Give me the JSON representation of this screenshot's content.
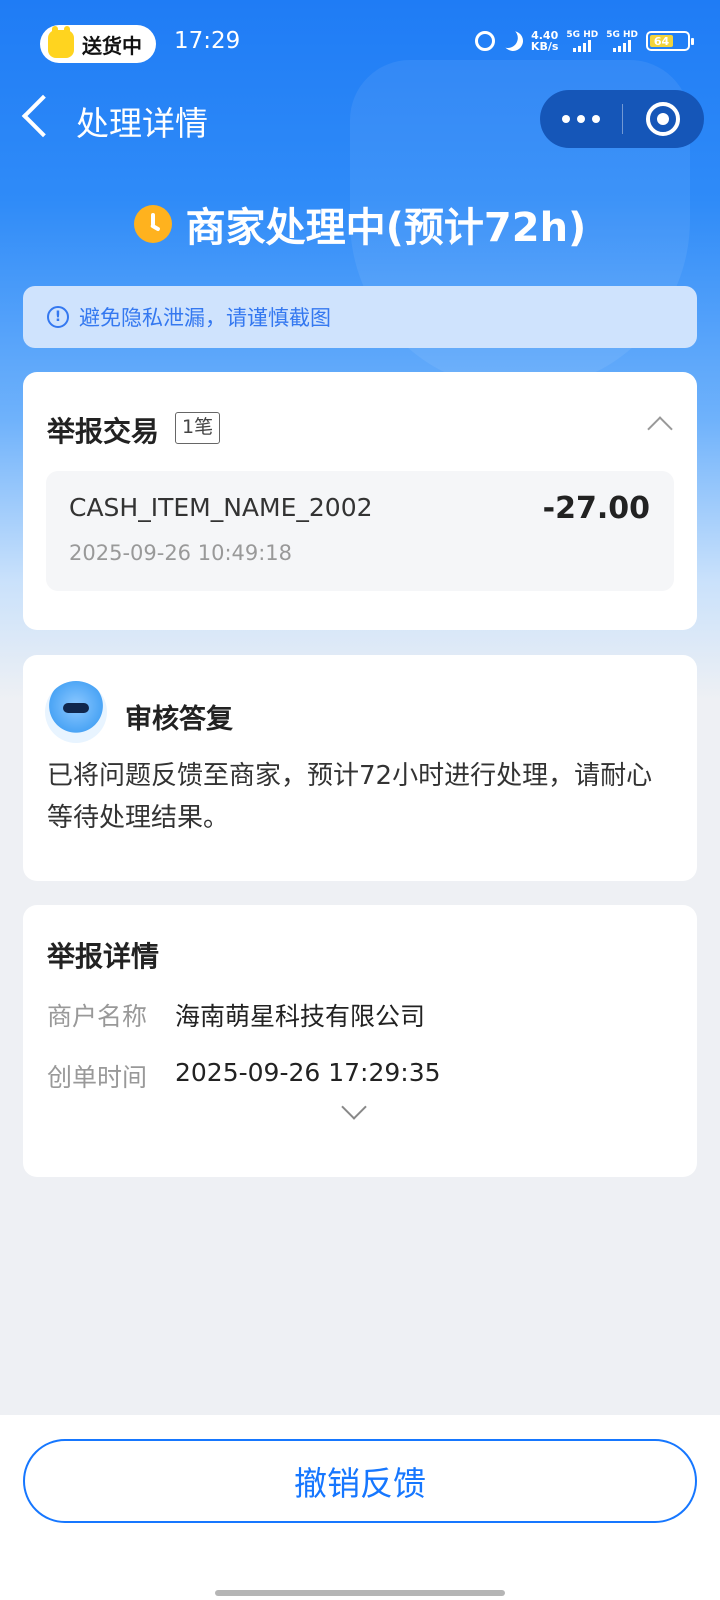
{
  "status_bar": {
    "pill_label": "送货中",
    "time": "17:29",
    "net_speed_value": "4.40",
    "net_speed_unit": "KB/s",
    "sim1": "5G HD",
    "sim2": "5G HD",
    "battery": "64"
  },
  "nav": {
    "title": "处理详情",
    "icons": [
      "back-icon",
      "more-icon",
      "target-icon"
    ]
  },
  "status": {
    "text": "商家处理中(预计72h)",
    "icon": "clock-icon",
    "color": "#ffb21e"
  },
  "notice": {
    "text": "避免隐私泄漏，请谨慎截图"
  },
  "report_transaction": {
    "title": "举报交易",
    "count": "1笔",
    "item": {
      "name": "CASH_ITEM_NAME_2002",
      "amount": "-27.00",
      "time": "2025-09-26 10:49:18"
    }
  },
  "review_reply": {
    "title": "审核答复",
    "body": "已将问题反馈至商家，预计72小时进行处理，请耐心等待处理结果。"
  },
  "report_details": {
    "title": "举报详情",
    "rows": [
      {
        "label": "商户名称",
        "value": "海南萌星科技有限公司"
      },
      {
        "label": "创单时间",
        "value": "2025-09-26 17:29:35"
      }
    ]
  },
  "footer": {
    "cancel_label": "撤销反馈"
  },
  "colors": {
    "brand_blue": "#1677ff",
    "header_blue": "#1f7cf5",
    "page_bg": "#eef0f4"
  }
}
